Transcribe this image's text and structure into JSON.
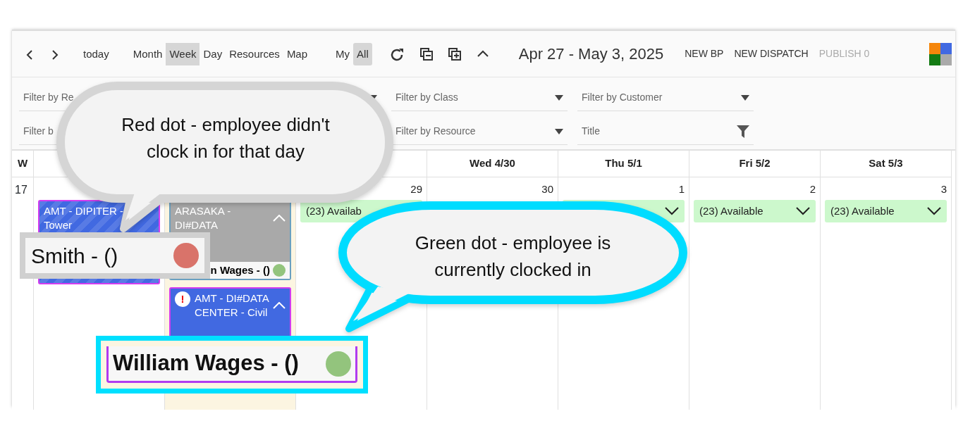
{
  "toolbar": {
    "nav": [
      {
        "kind": "prev"
      },
      {
        "kind": "next"
      }
    ],
    "today": "today",
    "views": [
      {
        "label": "Month",
        "selected": false
      },
      {
        "label": "Week",
        "selected": true
      },
      {
        "label": "Day",
        "selected": false
      },
      {
        "label": "Resources",
        "selected": false
      },
      {
        "label": "Map",
        "selected": false
      }
    ],
    "scope": [
      {
        "label": "My",
        "selected": false
      },
      {
        "label": "All",
        "selected": true
      }
    ],
    "title": "Apr 27 - May 3, 2025",
    "actions": [
      {
        "label": "NEW BP",
        "disabled": false
      },
      {
        "label": "NEW DISPATCH",
        "disabled": false
      },
      {
        "label": "PUBLISH 0",
        "disabled": true
      }
    ]
  },
  "filters": [
    [
      {
        "kind": "text",
        "placeholder": "Filter by Re"
      },
      {
        "kind": "dropdown"
      },
      {
        "kind": "dropdown",
        "placeholder": "Filter by Class"
      },
      {
        "kind": "dropdown",
        "placeholder": "Filter by Customer"
      }
    ],
    [
      {
        "kind": "text",
        "placeholder": "Filter b"
      },
      {
        "kind": "dropdown",
        "placeholder": "Filter by Resource"
      },
      {
        "kind": "search",
        "placeholder": "Title"
      }
    ]
  ],
  "calendar": {
    "week_header": "W",
    "week_number": "17",
    "days": [
      {
        "selected": false,
        "events": [
          {
            "kind": "job",
            "title": "AMT - DIPITER - Tower",
            "color": "#4169e1",
            "striped": true
          }
        ]
      },
      {
        "selected": true,
        "events": [
          {
            "kind": "job",
            "title": "ARASAKA - DI#DATA",
            "color": "#a9a9a9",
            "crew": {
              "name": "n Wages - ()",
              "color": "#93c47d"
            }
          },
          {
            "kind": "job",
            "title": "AMT - DI#DATA CENTER - Civil",
            "color": "#4169e1",
            "alert": "!"
          }
        ]
      },
      {
        "selected": false,
        "number": "29",
        "events": [
          {
            "kind": "clipped",
            "label": "(23) Availab"
          }
        ]
      },
      {
        "selected": false,
        "header": "Wed 4/30",
        "number": "30"
      },
      {
        "selected": false,
        "header": "Thu 5/1",
        "number": "1",
        "events": [
          {
            "kind": "available"
          }
        ]
      },
      {
        "selected": false,
        "header": "Fri 5/2",
        "number": "2",
        "events": [
          {
            "kind": "available",
            "label": "(23) Available"
          }
        ]
      },
      {
        "selected": false,
        "header": "Sat 5/3",
        "number": "3",
        "events": [
          {
            "kind": "available",
            "label": "(23) Available"
          }
        ]
      }
    ]
  },
  "callouts": [
    {
      "text": "Red dot - employee didn't clock in for that day",
      "zoom": {
        "name": "Smith - ()",
        "color": "#d9736a"
      }
    },
    {
      "text": "Green dot - employee is currently clocked in",
      "zoom": {
        "name": "William Wages - ()",
        "color": "#93c47d"
      }
    }
  ]
}
